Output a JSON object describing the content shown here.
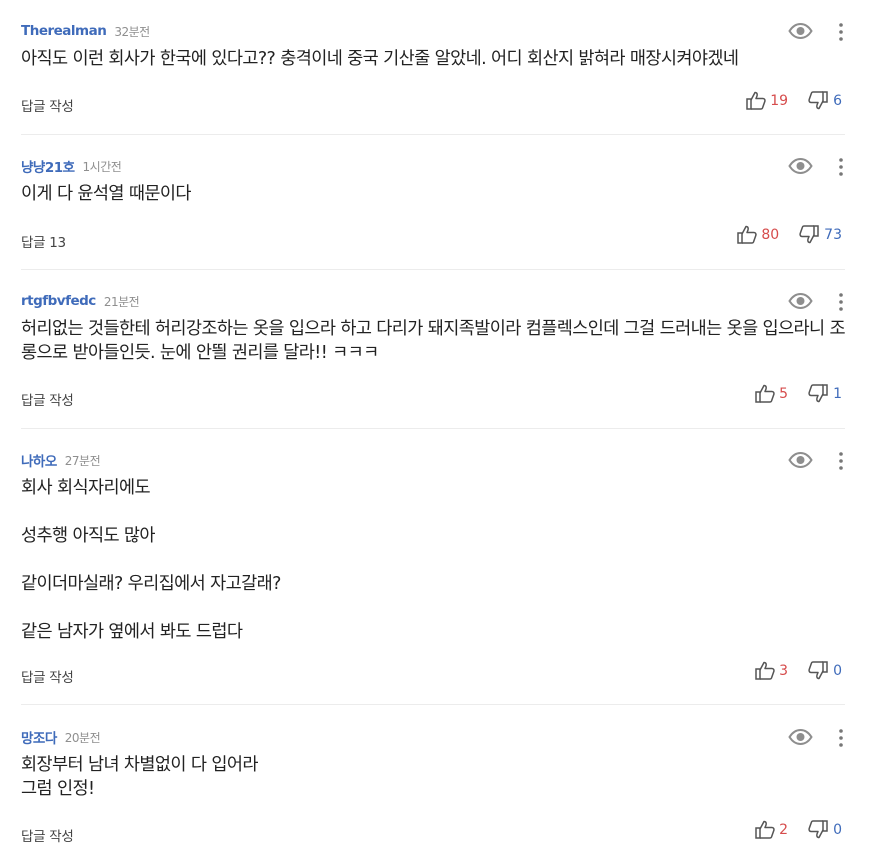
{
  "ui": {
    "reply_label": "답글 작성",
    "reply_count_label": "답글"
  },
  "colors": {
    "nickname": "#3f6bba",
    "like_count": "#d64c4c",
    "dislike_count": "#3f6bba",
    "body_text": "#222222",
    "meta_text": "#8f8f8f",
    "divider": "#ececec"
  },
  "icons": {
    "view": "eye-icon",
    "more": "more-vertical-icon",
    "like": "thumbs-up-icon",
    "dislike": "thumbs-down-icon"
  },
  "comments": [
    {
      "nickname": "Therealman",
      "time": "32분전",
      "text": "아직도 이런 회사가 한국에 있다고?? 충격이네 중국 기산줄 알았네. 어디 회산지 밝혀라 매장시켜야겠네",
      "reply": "답글 작성",
      "reply_count": "",
      "likes": "19",
      "dislikes": "6"
    },
    {
      "nickname": "냥냥21호",
      "time": "1시간전",
      "text": "이게 다 윤석열 때문이다",
      "reply": "답글",
      "reply_count": "13",
      "likes": "80",
      "dislikes": "73"
    },
    {
      "nickname": "rtgfbvfedc",
      "time": "21분전",
      "text": "허리없는 것들한테 허리강조하는 옷을 입으라 하고 다리가 돼지족발이라 컴플렉스인데 그걸 드러내는 옷을 입으라니 조롱으로 받아들인듯. 눈에 안띌 권리를 달라!! ㅋㅋㅋ",
      "reply": "답글 작성",
      "reply_count": "",
      "likes": "5",
      "dislikes": "1"
    },
    {
      "nickname": "나하오",
      "time": "27분전",
      "text": "회사 회식자리에도\n\n성추행 아직도 많아\n\n같이더마실래? 우리집에서 자고갈래?\n\n같은 남자가 옆에서 봐도 드럽다",
      "reply": "답글 작성",
      "reply_count": "",
      "likes": "3",
      "dislikes": "0"
    },
    {
      "nickname": "망조다",
      "time": "20분전",
      "text": "회장부터 남녀 차별없이 다 입어라\n그럼 인정!",
      "reply": "답글 작성",
      "reply_count": "",
      "likes": "2",
      "dislikes": "0"
    }
  ]
}
